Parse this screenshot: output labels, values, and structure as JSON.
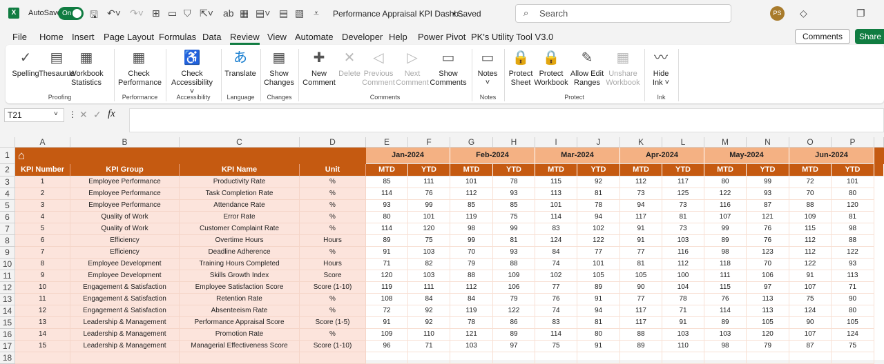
{
  "app": {
    "autosave_label": "AutoSave",
    "autosave_state": "On",
    "doc_title": "Performance Appraisal KPI Dashb...",
    "save_status": "• Saved",
    "search_placeholder": "Search",
    "user_initials": "PS"
  },
  "tabs": [
    "File",
    "Home",
    "Insert",
    "Page Layout",
    "Formulas",
    "Data",
    "Review",
    "View",
    "Automate",
    "Developer",
    "Help",
    "Power Pivot",
    "PK's Utility Tool V3.0"
  ],
  "active_tab": "Review",
  "header_buttons": {
    "comments": "Comments",
    "share": "Share"
  },
  "ribbon": {
    "buttons": [
      {
        "l1": "Spelling",
        "l2": "",
        "icon": "spelling-icon",
        "enabled": true
      },
      {
        "l1": "Thesaurus",
        "l2": "",
        "icon": "thesaurus-icon",
        "enabled": true
      },
      {
        "l1": "Workbook",
        "l2": "Statistics",
        "icon": "workbook-statistics-icon",
        "enabled": true
      },
      {
        "l1": "Check",
        "l2": "Performance",
        "icon": "check-performance-icon",
        "enabled": true
      },
      {
        "l1": "Check",
        "l2": "Accessibility ˅",
        "icon": "accessibility-icon",
        "enabled": true
      },
      {
        "l1": "Translate",
        "l2": "",
        "icon": "translate-icon",
        "enabled": true
      },
      {
        "l1": "Show",
        "l2": "Changes",
        "icon": "show-changes-icon",
        "enabled": true
      },
      {
        "l1": "New",
        "l2": "Comment",
        "icon": "new-comment-icon",
        "enabled": true
      },
      {
        "l1": "Delete",
        "l2": "",
        "icon": "delete-comment-icon",
        "enabled": false
      },
      {
        "l1": "Previous",
        "l2": "Comment",
        "icon": "previous-comment-icon",
        "enabled": false
      },
      {
        "l1": "Next",
        "l2": "Comment",
        "icon": "next-comment-icon",
        "enabled": false
      },
      {
        "l1": "Show",
        "l2": "Comments",
        "icon": "show-comments-icon",
        "enabled": true
      },
      {
        "l1": "Notes",
        "l2": "˅",
        "icon": "notes-icon",
        "enabled": true
      },
      {
        "l1": "Protect",
        "l2": "Sheet",
        "icon": "protect-sheet-icon",
        "enabled": true
      },
      {
        "l1": "Protect",
        "l2": "Workbook",
        "icon": "protect-workbook-icon",
        "enabled": true
      },
      {
        "l1": "Allow Edit",
        "l2": "Ranges",
        "icon": "allow-edit-ranges-icon",
        "enabled": true
      },
      {
        "l1": "Unshare",
        "l2": "Workbook",
        "icon": "unshare-workbook-icon",
        "enabled": false
      },
      {
        "l1": "Hide",
        "l2": "Ink ˅",
        "icon": "hide-ink-icon",
        "enabled": true
      }
    ],
    "groups": [
      "Proofing",
      "Performance",
      "Accessibility",
      "Language",
      "Changes",
      "Comments",
      "Notes",
      "Protect",
      "Ink"
    ]
  },
  "formula_bar": {
    "name_box": "T21",
    "formula": ""
  },
  "sheet": {
    "columns": [
      "A",
      "B",
      "C",
      "D",
      "E",
      "F",
      "G",
      "H",
      "I",
      "J",
      "K",
      "L",
      "M",
      "N",
      "O",
      "P"
    ],
    "row_numbers": [
      "1",
      "2",
      "3",
      "4",
      "5",
      "6",
      "7",
      "8",
      "9",
      "10",
      "11",
      "12",
      "13",
      "14",
      "15",
      "16",
      "17",
      "18"
    ],
    "months": [
      "Jan-2024",
      "Feb-2024",
      "Mar-2024",
      "Apr-2024",
      "May-2024",
      "Jun-2024"
    ],
    "headers": [
      "KPI Number",
      "KPI Group",
      "KPI Name",
      "Unit"
    ],
    "sub_headers": [
      "MTD",
      "YTD"
    ],
    "colors": {
      "header": "#C55A11",
      "month": "#F4B183",
      "left_fill": "#FCE4DC"
    },
    "rows": [
      {
        "num": "1",
        "group": "Employee Performance",
        "name": "Productivity Rate",
        "unit": "%",
        "vals": [
          85,
          111,
          101,
          78,
          115,
          92,
          112,
          117,
          80,
          99,
          72,
          101
        ]
      },
      {
        "num": "2",
        "group": "Employee Performance",
        "name": "Task Completion Rate",
        "unit": "%",
        "vals": [
          114,
          76,
          112,
          93,
          113,
          81,
          73,
          125,
          122,
          93,
          70,
          80
        ]
      },
      {
        "num": "3",
        "group": "Employee Performance",
        "name": "Attendance Rate",
        "unit": "%",
        "vals": [
          93,
          99,
          85,
          85,
          101,
          78,
          94,
          73,
          116,
          87,
          88,
          120
        ]
      },
      {
        "num": "4",
        "group": "Quality of Work",
        "name": "Error Rate",
        "unit": "%",
        "vals": [
          80,
          101,
          119,
          75,
          114,
          94,
          117,
          81,
          107,
          121,
          109,
          81
        ]
      },
      {
        "num": "5",
        "group": "Quality of Work",
        "name": "Customer Complaint Rate",
        "unit": "%",
        "vals": [
          114,
          120,
          98,
          99,
          83,
          102,
          91,
          73,
          99,
          76,
          115,
          98
        ]
      },
      {
        "num": "6",
        "group": "Efficiency",
        "name": "Overtime Hours",
        "unit": "Hours",
        "vals": [
          89,
          75,
          99,
          81,
          124,
          122,
          91,
          103,
          89,
          76,
          112,
          88
        ]
      },
      {
        "num": "7",
        "group": "Efficiency",
        "name": "Deadline Adherence",
        "unit": "%",
        "vals": [
          91,
          103,
          70,
          93,
          84,
          77,
          77,
          116,
          98,
          123,
          112,
          122
        ]
      },
      {
        "num": "8",
        "group": "Employee Development",
        "name": "Training Hours Completed",
        "unit": "Hours",
        "vals": [
          71,
          82,
          79,
          88,
          74,
          101,
          81,
          112,
          118,
          70,
          122,
          93
        ]
      },
      {
        "num": "9",
        "group": "Employee Development",
        "name": "Skills Growth Index",
        "unit": "Score",
        "vals": [
          120,
          103,
          88,
          109,
          102,
          105,
          105,
          100,
          111,
          106,
          91,
          113
        ]
      },
      {
        "num": "10",
        "group": "Engagement & Satisfaction",
        "name": "Employee Satisfaction Score",
        "unit": "Score (1-10)",
        "vals": [
          119,
          111,
          112,
          106,
          77,
          89,
          90,
          104,
          115,
          97,
          107,
          71
        ]
      },
      {
        "num": "11",
        "group": "Engagement & Satisfaction",
        "name": "Retention Rate",
        "unit": "%",
        "vals": [
          108,
          84,
          84,
          79,
          76,
          91,
          77,
          78,
          76,
          113,
          75,
          90
        ]
      },
      {
        "num": "12",
        "group": "Engagement & Satisfaction",
        "name": "Absenteeism Rate",
        "unit": "%",
        "vals": [
          72,
          92,
          119,
          122,
          74,
          94,
          117,
          71,
          114,
          113,
          124,
          80
        ]
      },
      {
        "num": "13",
        "group": "Leadership & Management",
        "name": "Performance Appraisal Score",
        "unit": "Score (1-5)",
        "vals": [
          91,
          92,
          78,
          86,
          83,
          81,
          117,
          91,
          89,
          105,
          90,
          105
        ]
      },
      {
        "num": "14",
        "group": "Leadership & Management",
        "name": "Promotion Rate",
        "unit": "%",
        "vals": [
          109,
          110,
          121,
          89,
          114,
          80,
          88,
          103,
          103,
          120,
          107,
          124
        ]
      },
      {
        "num": "15",
        "group": "Leadership & Management",
        "name": "Managerial Effectiveness Score",
        "unit": "Score (1-10)",
        "vals": [
          96,
          71,
          103,
          97,
          75,
          91,
          89,
          110,
          98,
          79,
          87,
          75
        ]
      }
    ]
  }
}
